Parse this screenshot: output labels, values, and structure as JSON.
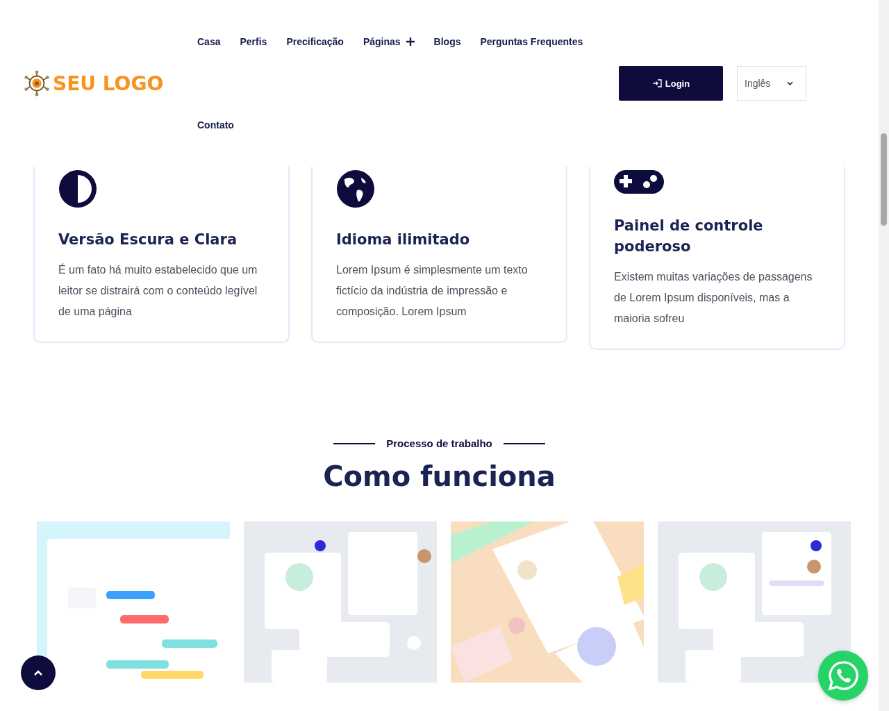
{
  "logo": {
    "text": "SEU LOGO"
  },
  "nav": [
    {
      "label": "Casa",
      "kind": "link"
    },
    {
      "label": "Perfis",
      "kind": "link"
    },
    {
      "label": "Precificação",
      "kind": "link"
    },
    {
      "label": "Páginas",
      "kind": "dropdown"
    },
    {
      "label": "Blogs",
      "kind": "link"
    },
    {
      "label": "Perguntas Frequentes",
      "kind": "link"
    },
    {
      "label": "Contato",
      "kind": "link"
    }
  ],
  "login_button": {
    "label": "Login"
  },
  "language_select": {
    "value": "Inglês"
  },
  "features": [
    {
      "kind": "contrast",
      "title": "Versão Escura e Clara",
      "text": "É um fato há muito estabelecido que um leitor se distrairá com o conteúdo legível de uma página"
    },
    {
      "kind": "globe",
      "title": "Idioma ilimitado",
      "text": "Lorem Ipsum é simplesmente um texto fictício da indústria de impressão e composição. Lorem Ipsum"
    },
    {
      "kind": "gamepad",
      "title": "Painel de controle poderoso",
      "text": "Existem muitas variações de passagens de Lorem Ipsum disponíveis, mas a maioria sofreu"
    }
  ],
  "process": {
    "eyebrow": "Processo de trabalho",
    "title": "Como funciona"
  }
}
